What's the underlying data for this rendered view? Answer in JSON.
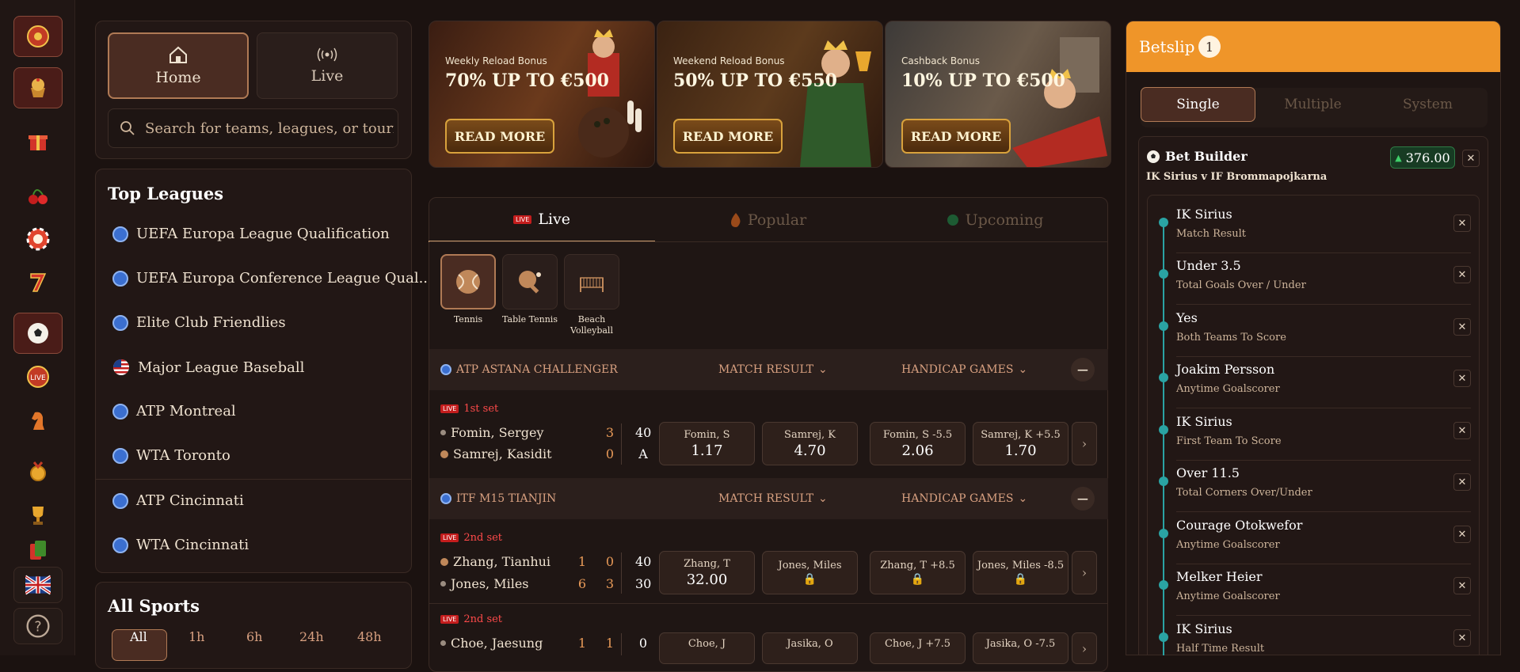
{
  "sidebar": {
    "icons": [
      "roulette-icon",
      "cupcake-icon",
      "gift-icon",
      "cherry-icon",
      "chip-icon",
      "seven-icon",
      "soccer-ball-icon",
      "live-icon",
      "chess-knight-icon",
      "medal-icon",
      "trophy-icon",
      "cards-icon"
    ],
    "language_flag": "uk-flag-icon",
    "help_icon": "question-icon"
  },
  "nav": {
    "home_label": "Home",
    "live_label": "Live",
    "search_placeholder": "Search for teams, leagues, or tournaments"
  },
  "top_leagues": {
    "title": "Top Leagues",
    "items": [
      "UEFA Europa League Qualification",
      "UEFA Europa Conference League Qual...",
      "Elite Club Friendlies",
      "Major League Baseball",
      "ATP Montreal",
      "WTA Toronto",
      "ATP Cincinnati",
      "WTA Cincinnati"
    ]
  },
  "all_sports": {
    "title": "All Sports",
    "filters": [
      "All",
      "1h",
      "6h",
      "24h",
      "48h"
    ]
  },
  "banners": [
    {
      "sub": "Weekly Reload Bonus",
      "big": "70% UP TO €500",
      "button": "READ MORE"
    },
    {
      "sub": "Weekend Reload Bonus",
      "big": "50% UP TO €550",
      "button": "READ MORE"
    },
    {
      "sub": "Cashback Bonus",
      "big": "10% UP TO €500",
      "button": "READ MORE"
    }
  ],
  "tabs": {
    "live": "Live",
    "popular": "Popular",
    "upcoming": "Upcoming",
    "live_badge": "LIVE"
  },
  "sports": [
    "Tennis",
    "Table Tennis",
    "Beach Volleyball"
  ],
  "sections": [
    {
      "title": "ATP ASTANA CHALLENGER",
      "market1": "MATCH RESULT",
      "market2": "HANDICAP GAMES",
      "match": {
        "status": "1st set",
        "p1": "Fomin, Sergey",
        "p2": "Samrej, Kasidit",
        "p1_set": "3",
        "p2_set": "0",
        "p1_pts": "40",
        "p2_pts": "A",
        "odds": [
          {
            "label": "Fomin, S",
            "value": "1.17"
          },
          {
            "label": "Samrej, K",
            "value": "4.70"
          },
          {
            "label": "Fomin, S -5.5",
            "value": "2.06"
          },
          {
            "label": "Samrej, K +5.5",
            "value": "1.70"
          }
        ]
      }
    },
    {
      "title": "ITF M15 TIANJIN",
      "market1": "MATCH RESULT",
      "market2": "HANDICAP GAMES",
      "match": {
        "status": "2nd set",
        "p1": "Zhang, Tianhui",
        "p2": "Jones, Miles",
        "p1_s1": "1",
        "p1_s2": "0",
        "p2_s1": "6",
        "p2_s2": "3",
        "p1_pts": "40",
        "p2_pts": "30",
        "odds": [
          {
            "label": "Zhang, T",
            "value": "32.00"
          },
          {
            "label": "Jones, Miles",
            "value": ""
          },
          {
            "label": "Zhang, T +8.5",
            "value": ""
          },
          {
            "label": "Jones, Miles -8.5",
            "value": ""
          }
        ]
      }
    },
    {
      "match": {
        "status": "2nd set",
        "p1": "Choe, Jaesung",
        "p1_s1": "1",
        "p1_s2": "1",
        "p1_pts": "0",
        "odds": [
          {
            "label": "Choe, J"
          },
          {
            "label": "Jasika, O"
          },
          {
            "label": "Choe, J +7.5"
          },
          {
            "label": "Jasika, O -7.5"
          }
        ]
      }
    }
  ],
  "betslip": {
    "title": "Betslip",
    "count": "1",
    "tabs": [
      "Single",
      "Multiple",
      "System"
    ],
    "builder_title": "Bet Builder",
    "builder_odds": "376.00",
    "match": "IK Sirius v IF Brommapojkarna",
    "selections": [
      {
        "name": "IK Sirius",
        "market": "Match Result"
      },
      {
        "name": "Under 3.5",
        "market": "Total Goals Over / Under"
      },
      {
        "name": "Yes",
        "market": "Both Teams To Score"
      },
      {
        "name": "Joakim Persson",
        "market": "Anytime Goalscorer"
      },
      {
        "name": "IK Sirius",
        "market": "First Team To Score"
      },
      {
        "name": "Over 11.5",
        "market": "Total Corners Over/Under"
      },
      {
        "name": "Courage Otokwefor",
        "market": "Anytime Goalscorer"
      },
      {
        "name": "Melker Heier",
        "market": "Anytime Goalscorer"
      },
      {
        "name": "IK Sirius",
        "market": "Half Time Result"
      }
    ]
  },
  "colors": {
    "accent": "#ef9529",
    "live_red": "#c41d1d",
    "timeline": "#2aa3a3",
    "odds_up": "#1d5b33"
  }
}
